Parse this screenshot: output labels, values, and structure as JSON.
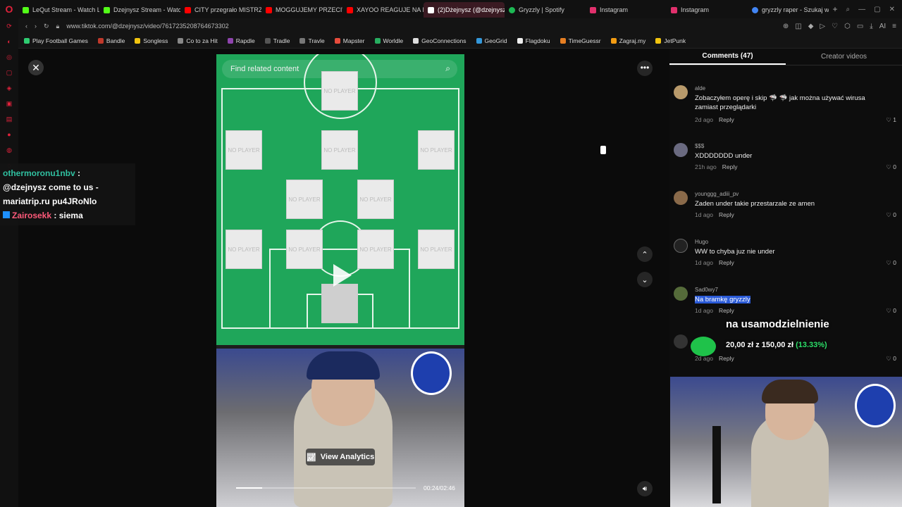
{
  "browser": {
    "tabs": [
      {
        "label": "LeQut Stream - Watch L",
        "color": "#53fc18"
      },
      {
        "label": "Dzejnysz Stream - Watc",
        "color": "#53fc18"
      },
      {
        "label": "CITY przegrało MISTRZ",
        "color": "#ff0000"
      },
      {
        "label": "MOGGUJEMY PRZECIW",
        "color": "#ff0000"
      },
      {
        "label": "XAYOO REAGUJE NA N",
        "color": "#ff0000"
      },
      {
        "label": "(2)Dżejnysz (@dzejnysz)",
        "color": "#ffffff"
      },
      {
        "label": "Gryzzly | Spotify",
        "color": "#1db954"
      },
      {
        "label": "Instagram",
        "color": "#e1306c"
      },
      {
        "label": "Instagram",
        "color": "#e1306c"
      },
      {
        "label": "gryzzly raper - Szukaj w",
        "color": "#4285f4"
      }
    ],
    "url": "www.tiktok.com/@dzejnysz/video/7617235208764673302",
    "bookmarks": [
      "Play Football Games",
      "Bandle",
      "Songless",
      "Co to za Hit",
      "Rapdle",
      "Tradle",
      "Travle",
      "Mapster",
      "Worldle",
      "GeoConnections",
      "GeoGrid",
      "Flagdoku",
      "TimeGuessr",
      "Zagraj.my",
      "JetPunk"
    ]
  },
  "chat": [
    {
      "user": "othermoronu1nbv",
      "sep": " :",
      "text": "@dzejnysz come to us - mariatrip.ru pu4JRoNlo"
    },
    {
      "user": "Zairosekk",
      "sep": " :",
      "text": "siema"
    }
  ],
  "video": {
    "search_placeholder": "Find related content",
    "analytics_label": "View Analytics",
    "time": "00:24/02:46",
    "progress": 0.145,
    "card_label": "NO PLAYER"
  },
  "comments_panel": {
    "tab_comments": "Comments (47)",
    "tab_creator": "Creator videos",
    "reply_label": "Reply",
    "comments": [
      {
        "user": "alde",
        "text": "Zobaczyłem operę i skip 🦈 🦈 jak można używać wirusa zamiast przeglądarki",
        "time": "2d ago",
        "likes": "1"
      },
      {
        "user": "$$$",
        "text": "XDDDDDDD under",
        "time": "21h ago",
        "likes": "0"
      },
      {
        "user": "younggg_adiii_pv",
        "text": "Zaden under takie przestarzale ze amen",
        "time": "1d ago",
        "likes": "0"
      },
      {
        "user": "Hugo",
        "text": "WW to chyba juz nie under",
        "time": "1d ago",
        "likes": "0"
      },
      {
        "user": "Sad0wy7",
        "text": "Na bramkę gryzzly",
        "time": "1d ago",
        "likes": "0"
      },
      {
        "user": "",
        "text": "",
        "time": "2d ago",
        "likes": "0"
      }
    ]
  },
  "donation": {
    "title": "na usamodzielnienie",
    "amount": "20,00 zł z 150,00 zł",
    "percent": "(13.33%)"
  }
}
